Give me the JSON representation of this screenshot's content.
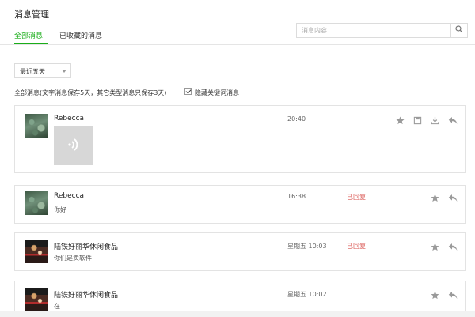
{
  "page": {
    "title": "消息管理"
  },
  "tabs": [
    {
      "label": "全部消息",
      "active": true
    },
    {
      "label": "已收藏的消息",
      "active": false
    }
  ],
  "search": {
    "placeholder": "消息内容",
    "value": ""
  },
  "filter": {
    "selected": "最近五天"
  },
  "note": "全部消息(文字消息保存5天，其它类型消息只保存3天)",
  "hide_keyword": {
    "label": "隐藏关键词消息",
    "checked": true
  },
  "messages": [
    {
      "sender": "Rebecca",
      "time": "20:40",
      "type": "voice",
      "content": "",
      "status": "",
      "actions": [
        "star-icon",
        "save-icon",
        "download-icon",
        "reply-icon"
      ]
    },
    {
      "sender": "Rebecca",
      "time": "16:38",
      "type": "text",
      "content": "你好",
      "status": "已回复",
      "actions": [
        "star-icon",
        "reply-icon"
      ]
    },
    {
      "sender": "陆铁好丽华休闲食品",
      "time": "星期五 10:03",
      "type": "text",
      "content": "你们是卖软件",
      "status": "已回复",
      "actions": [
        "star-icon",
        "reply-icon"
      ]
    },
    {
      "sender": "陆铁好丽华休闲食品",
      "time": "星期五 10:02",
      "type": "text",
      "content": "在",
      "status": "",
      "actions": [
        "star-icon",
        "reply-icon"
      ]
    }
  ],
  "colors": {
    "accent": "#1aad19",
    "replied": "#d9534f",
    "icon": "#9a9a9a"
  }
}
